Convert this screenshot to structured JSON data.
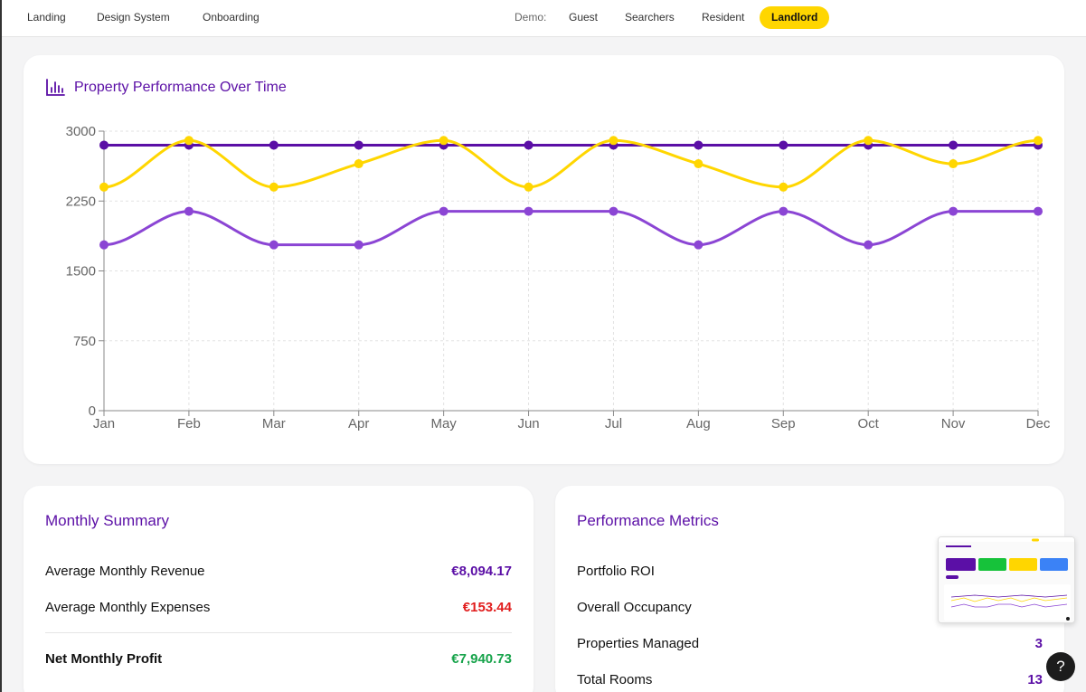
{
  "nav": {
    "links": [
      "Landing",
      "Design System",
      "Onboarding"
    ],
    "demo_label": "Demo:",
    "demo_options": [
      "Guest",
      "Searchers",
      "Resident",
      "Landlord"
    ],
    "active_demo": "Landlord"
  },
  "chart_card": {
    "title": "Property Performance Over Time",
    "icon": "bar-chart-icon"
  },
  "chart_data": {
    "type": "line",
    "categories": [
      "Jan",
      "Feb",
      "Mar",
      "Apr",
      "May",
      "Jun",
      "Jul",
      "Aug",
      "Sep",
      "Oct",
      "Nov",
      "Dec"
    ],
    "y_ticks": [
      "0",
      "750",
      "1500",
      "2250",
      "3000"
    ],
    "ylim": [
      0,
      3000
    ],
    "grid": true,
    "series": [
      {
        "color": "#5b0fa6",
        "values": [
          2850,
          2850,
          2850,
          2850,
          2850,
          2850,
          2850,
          2850,
          2850,
          2850,
          2850,
          2850
        ]
      },
      {
        "color": "#ffd600",
        "values": [
          2400,
          2900,
          2400,
          2650,
          2900,
          2400,
          2900,
          2650,
          2400,
          2900,
          2650,
          2900
        ]
      },
      {
        "color": "#8b45d4",
        "values": [
          1780,
          2140,
          1780,
          1780,
          2140,
          2140,
          2140,
          1780,
          2140,
          1780,
          2140,
          2140
        ]
      }
    ]
  },
  "summary": {
    "title": "Monthly Summary",
    "rows": [
      {
        "label": "Average Monthly Revenue",
        "value": "€8,094.17",
        "color": "#5b0fa6"
      },
      {
        "label": "Average Monthly Expenses",
        "value": "€153.44",
        "color": "#e11d1d"
      }
    ],
    "net": {
      "label": "Net Monthly Profit",
      "value": "€7,940.73",
      "color": "#16a34a"
    }
  },
  "metrics": {
    "title": "Performance Metrics",
    "rows": [
      {
        "label": "Portfolio ROI",
        "value": ""
      },
      {
        "label": "Overall Occupancy",
        "value": ""
      },
      {
        "label": "Properties Managed",
        "value": "3"
      },
      {
        "label": "Total Rooms",
        "value": "13"
      }
    ],
    "value_color": "#5b0fa6"
  },
  "help": {
    "label": "?"
  }
}
